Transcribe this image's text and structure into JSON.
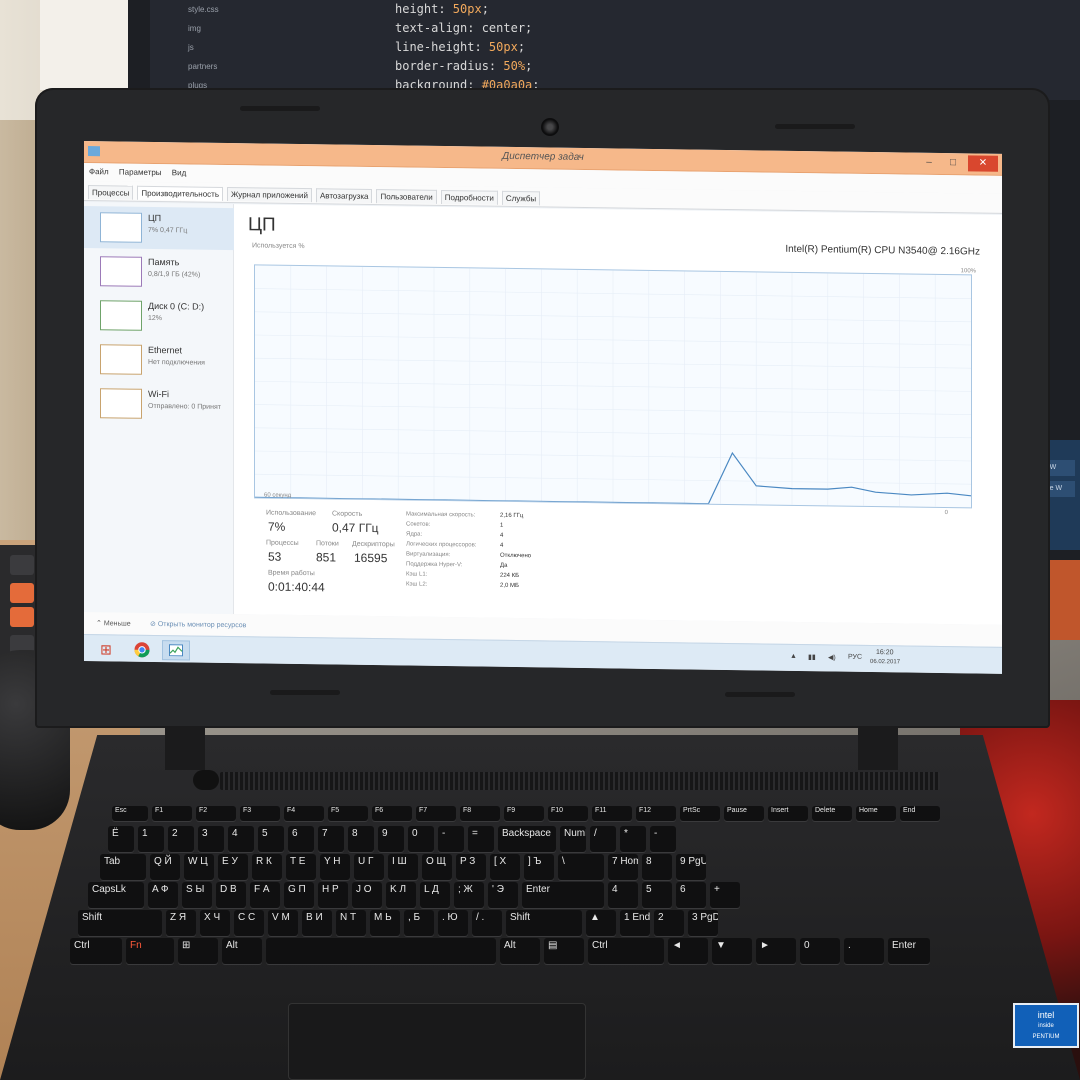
{
  "background_code": {
    "lines": [
      {
        "prop": "height: ",
        "val": "50px",
        "end": ";"
      },
      {
        "prop": "text-align: center;",
        "val": "",
        "end": ""
      },
      {
        "prop": "line-height: ",
        "val": "50px",
        "end": ";"
      },
      {
        "prop": "border-radius: ",
        "val": "50%",
        "end": ";"
      },
      {
        "prop": "background: ",
        "val": "#0a0a0a",
        "end": ";"
      }
    ],
    "tree_items": [
      "style.css",
      "img",
      "js",
      "partners",
      "plugs"
    ],
    "right_buttons": [
      "New W",
      "Replace W"
    ]
  },
  "window": {
    "title": "Диспетчер задач",
    "min_glyph": "–",
    "max_glyph": "□",
    "close_glyph": "✕"
  },
  "menu": [
    "Файл",
    "Параметры",
    "Вид"
  ],
  "tabs": [
    "Процессы",
    "Производительность",
    "Журнал приложений",
    "Автозагрузка",
    "Пользователи",
    "Подробности",
    "Службы"
  ],
  "sidebar": {
    "items": [
      {
        "name": "ЦП",
        "sub": "7% 0,47 ГГц"
      },
      {
        "name": "Память",
        "sub": "0,8/1,9 ГБ (42%)"
      },
      {
        "name": "Диск 0 (C: D:)",
        "sub": "12%"
      },
      {
        "name": "Ethernet",
        "sub": "Нет подключения"
      },
      {
        "name": "Wi-Fi",
        "sub": "Отправлено: 0 Принят"
      }
    ]
  },
  "cpu": {
    "title": "ЦП",
    "model": "Intel(R) Pentium(R) CPU N3540@ 2.16GHz",
    "usage_label": "Используется %",
    "max_label": "100%",
    "time_label": "60 секунд",
    "zero_label": "0",
    "stats": {
      "usage_label": "Использование",
      "usage": "7%",
      "speed_label": "Скорость",
      "speed": "0,47 ГГц",
      "processes_label": "Процессы",
      "processes": "53",
      "threads_label": "Потоки",
      "threads": "851",
      "handles_label": "Дескрипторы",
      "handles": "16595",
      "uptime_label": "Время работы",
      "uptime": "0:01:40:44"
    },
    "details": [
      {
        "label": "Максимальная скорость:",
        "value": "2,16 ГГц"
      },
      {
        "label": "Сокетов:",
        "value": "1"
      },
      {
        "label": "Ядра:",
        "value": "4"
      },
      {
        "label": "Логических процессоров:",
        "value": "4"
      },
      {
        "label": "Виртуализация:",
        "value": "Отключено"
      },
      {
        "label": "Поддержка Hyper-V:",
        "value": "Да"
      },
      {
        "label": "Кэш L1:",
        "value": "224 КБ"
      },
      {
        "label": "Кэш L2:",
        "value": "2,0 МБ"
      }
    ]
  },
  "chart_data": {
    "type": "line",
    "title": "",
    "xlabel": "60 секунд",
    "ylabel": "Используется %",
    "ylim": [
      0,
      100
    ],
    "x": [
      0,
      34,
      35,
      36,
      37,
      38,
      40,
      42,
      45,
      48,
      50,
      52,
      55,
      58,
      60
    ],
    "series": [
      {
        "name": "",
        "values": [
          0,
          0,
          0,
          0,
          0,
          0,
          22,
          8,
          7,
          7,
          8,
          6,
          5,
          6,
          5
        ]
      }
    ],
    "grid": false
  },
  "footer": {
    "less_label": "Меньше",
    "monitor_label": "Открыть монитор ресурсов"
  },
  "taskbar": {
    "lang": "РУС",
    "time": "16:20",
    "date": "06.02.2017"
  },
  "keyboard": {
    "row1": [
      "Esc",
      "F1",
      "F2",
      "F3",
      "F4",
      "F5",
      "F6",
      "F7",
      "F8",
      "F9",
      "F10",
      "F11",
      "F12",
      "PrtSc",
      "Pause",
      "Insert",
      "Delete",
      "Home",
      "End"
    ],
    "row2": [
      "Ё",
      "1",
      "2",
      "3",
      "4",
      "5",
      "6",
      "7",
      "8",
      "9",
      "0",
      "-",
      "=",
      "Backspace",
      "NumLk",
      "/",
      "*",
      "-"
    ],
    "row3": [
      "Tab",
      "Q Й",
      "W Ц",
      "E У",
      "R К",
      "T Е",
      "Y Н",
      "U Г",
      "I Ш",
      "O Щ",
      "P З",
      "[ Х",
      "] Ъ",
      "\\",
      "7 Home",
      "8",
      "9 PgUp"
    ],
    "row4": [
      "CapsLk",
      "A Ф",
      "S Ы",
      "D В",
      "F А",
      "G П",
      "H Р",
      "J О",
      "K Л",
      "L Д",
      "; Ж",
      "' Э",
      "Enter",
      "4",
      "5",
      "6",
      "+"
    ],
    "row5": [
      "Shift",
      "Z Я",
      "X Ч",
      "C С",
      "V М",
      "B И",
      "N Т",
      "M Ь",
      ", Б",
      ". Ю",
      "/ .",
      "Shift",
      "▲",
      "1 End",
      "2",
      "3 PgDn"
    ],
    "row6": [
      "Ctrl",
      "Fn",
      "⊞",
      "Alt",
      "",
      "Alt",
      "▤",
      "Ctrl",
      "◄",
      "▼",
      "►",
      "0",
      ".",
      "Enter"
    ]
  },
  "intel_badge": {
    "brand": "intel",
    "sub1": "inside",
    "sub2": "PENTIUM"
  },
  "colors": {
    "titlebar": "#f6b88a",
    "graph_line": "#4a88c2",
    "graph_border": "#a9c6e2",
    "taskbar": "#ddeaf5",
    "close_button": "#d9472e"
  }
}
